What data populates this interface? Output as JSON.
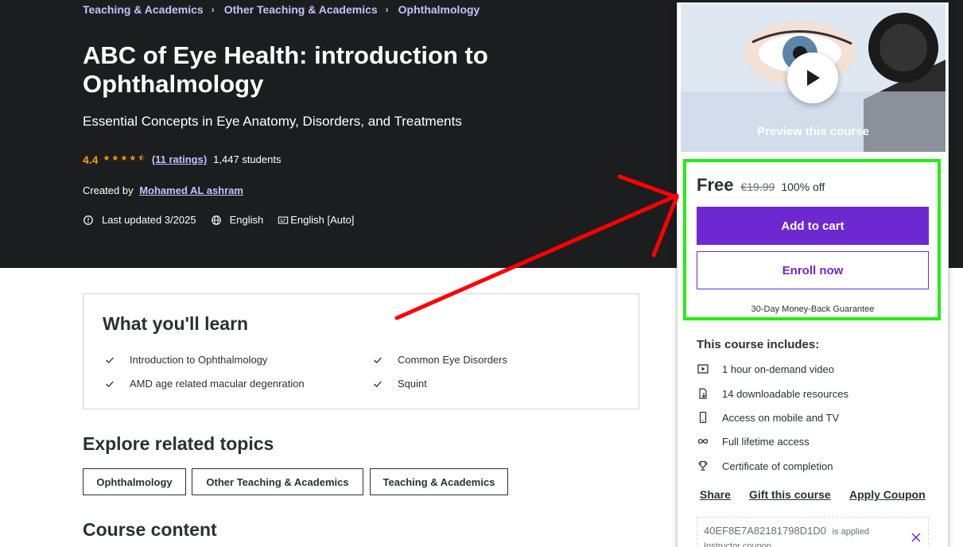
{
  "breadcrumb": [
    "Teaching & Academics",
    "Other Teaching & Academics",
    "Ophthalmology"
  ],
  "course": {
    "title": "ABC of Eye Health: introduction to Ophthalmology",
    "subtitle": "Essential Concepts in Eye Anatomy, Disorders, and Treatments",
    "rating": "4.4",
    "stars": "★★★★⯪",
    "ratings_count": "(11 ratings)",
    "students": "1,447 students",
    "created_by_label": "Created by",
    "author": "Mohamed AL ashram",
    "last_updated": "Last updated 3/2025",
    "language": "English",
    "captions": "English [Auto]"
  },
  "learn": {
    "title": "What you'll learn",
    "items": [
      "Introduction to Ophthalmology",
      "Common Eye Disorders",
      "AMD age related macular degenration",
      "Squint"
    ]
  },
  "related": {
    "title": "Explore related topics",
    "topics": [
      "Ophthalmology",
      "Other Teaching & Academics",
      "Teaching & Academics"
    ]
  },
  "course_content_title": "Course content",
  "sidebar": {
    "preview_label": "Preview this course",
    "price_now": "Free",
    "price_old": "€19.99",
    "discount": "100% off",
    "add_to_cart": "Add to cart",
    "enroll_now": "Enroll now",
    "guarantee": "30-Day Money-Back Guarantee",
    "includes_title": "This course includes:",
    "includes": [
      {
        "icon": "video-icon",
        "label": "1 hour on-demand video"
      },
      {
        "icon": "download-file-icon",
        "label": "14 downloadable resources"
      },
      {
        "icon": "mobile-icon",
        "label": "Access on mobile and TV"
      },
      {
        "icon": "infinity-icon",
        "label": "Full lifetime access"
      },
      {
        "icon": "trophy-icon",
        "label": "Certificate of completion"
      }
    ],
    "actions": {
      "share": "Share",
      "gift": "Gift this course",
      "coupon": "Apply Coupon"
    },
    "coupon": {
      "code": "40EF8E7A82181798D1D0",
      "applied": "is applied",
      "type": "Instructor coupon"
    }
  },
  "colors": {
    "hero_bg": "#1c1d1f",
    "accent_purple": "#6d28d2",
    "link_lavender": "#c0c4fc",
    "star_orange": "#f69c08",
    "highlight_green": "#22ee11",
    "annotation_red": "#ff0000"
  }
}
